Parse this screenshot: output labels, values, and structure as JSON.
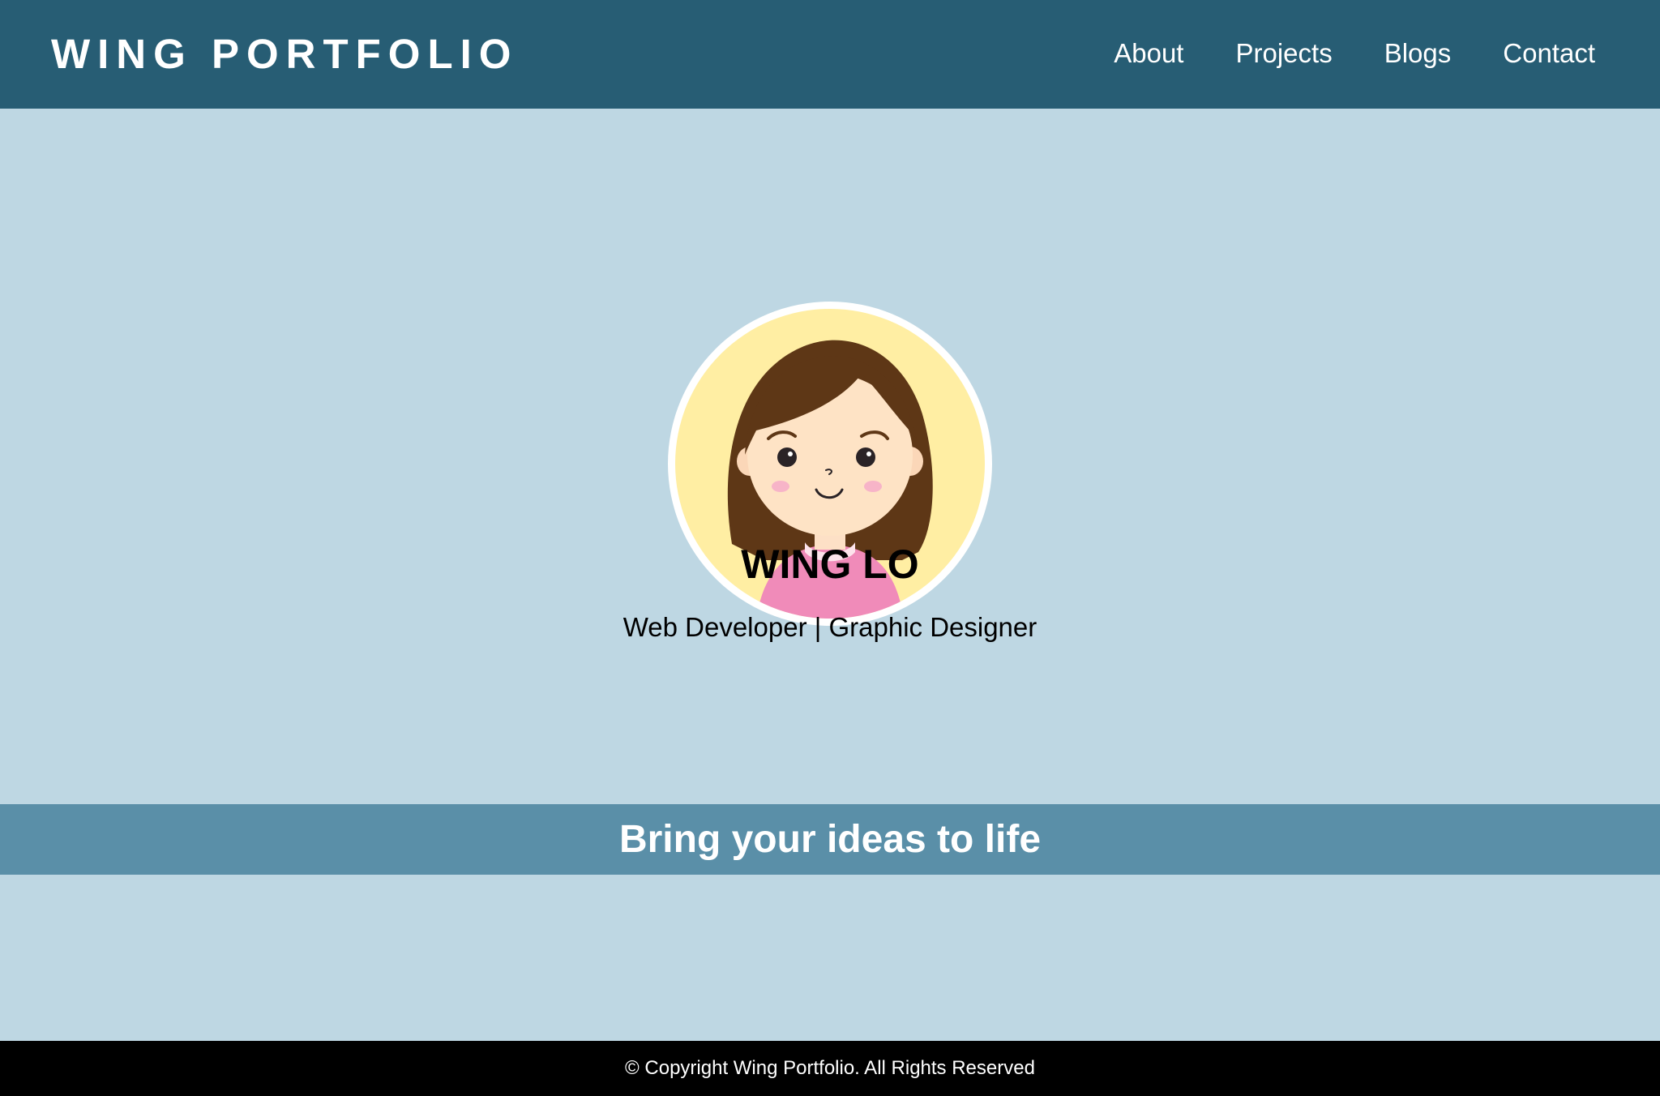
{
  "header": {
    "brand": "WING PORTFOLIO",
    "nav": [
      {
        "label": "About"
      },
      {
        "label": "Projects"
      },
      {
        "label": "Blogs"
      },
      {
        "label": "Contact"
      }
    ]
  },
  "profile": {
    "name": "WING LO",
    "role": "Web Developer | Graphic Designer",
    "avatar_icon": "girl-avatar-icon"
  },
  "banner": {
    "text": "Bring your ideas to life"
  },
  "footer": {
    "copyright": "© Copyright Wing Portfolio. All Rights Reserved"
  },
  "colors": {
    "header_bg": "#275d74",
    "page_bg": "#bed7e3",
    "banner_bg": "#5a8fa8",
    "footer_bg": "#000000",
    "avatar_bg": "#ffeea3"
  }
}
